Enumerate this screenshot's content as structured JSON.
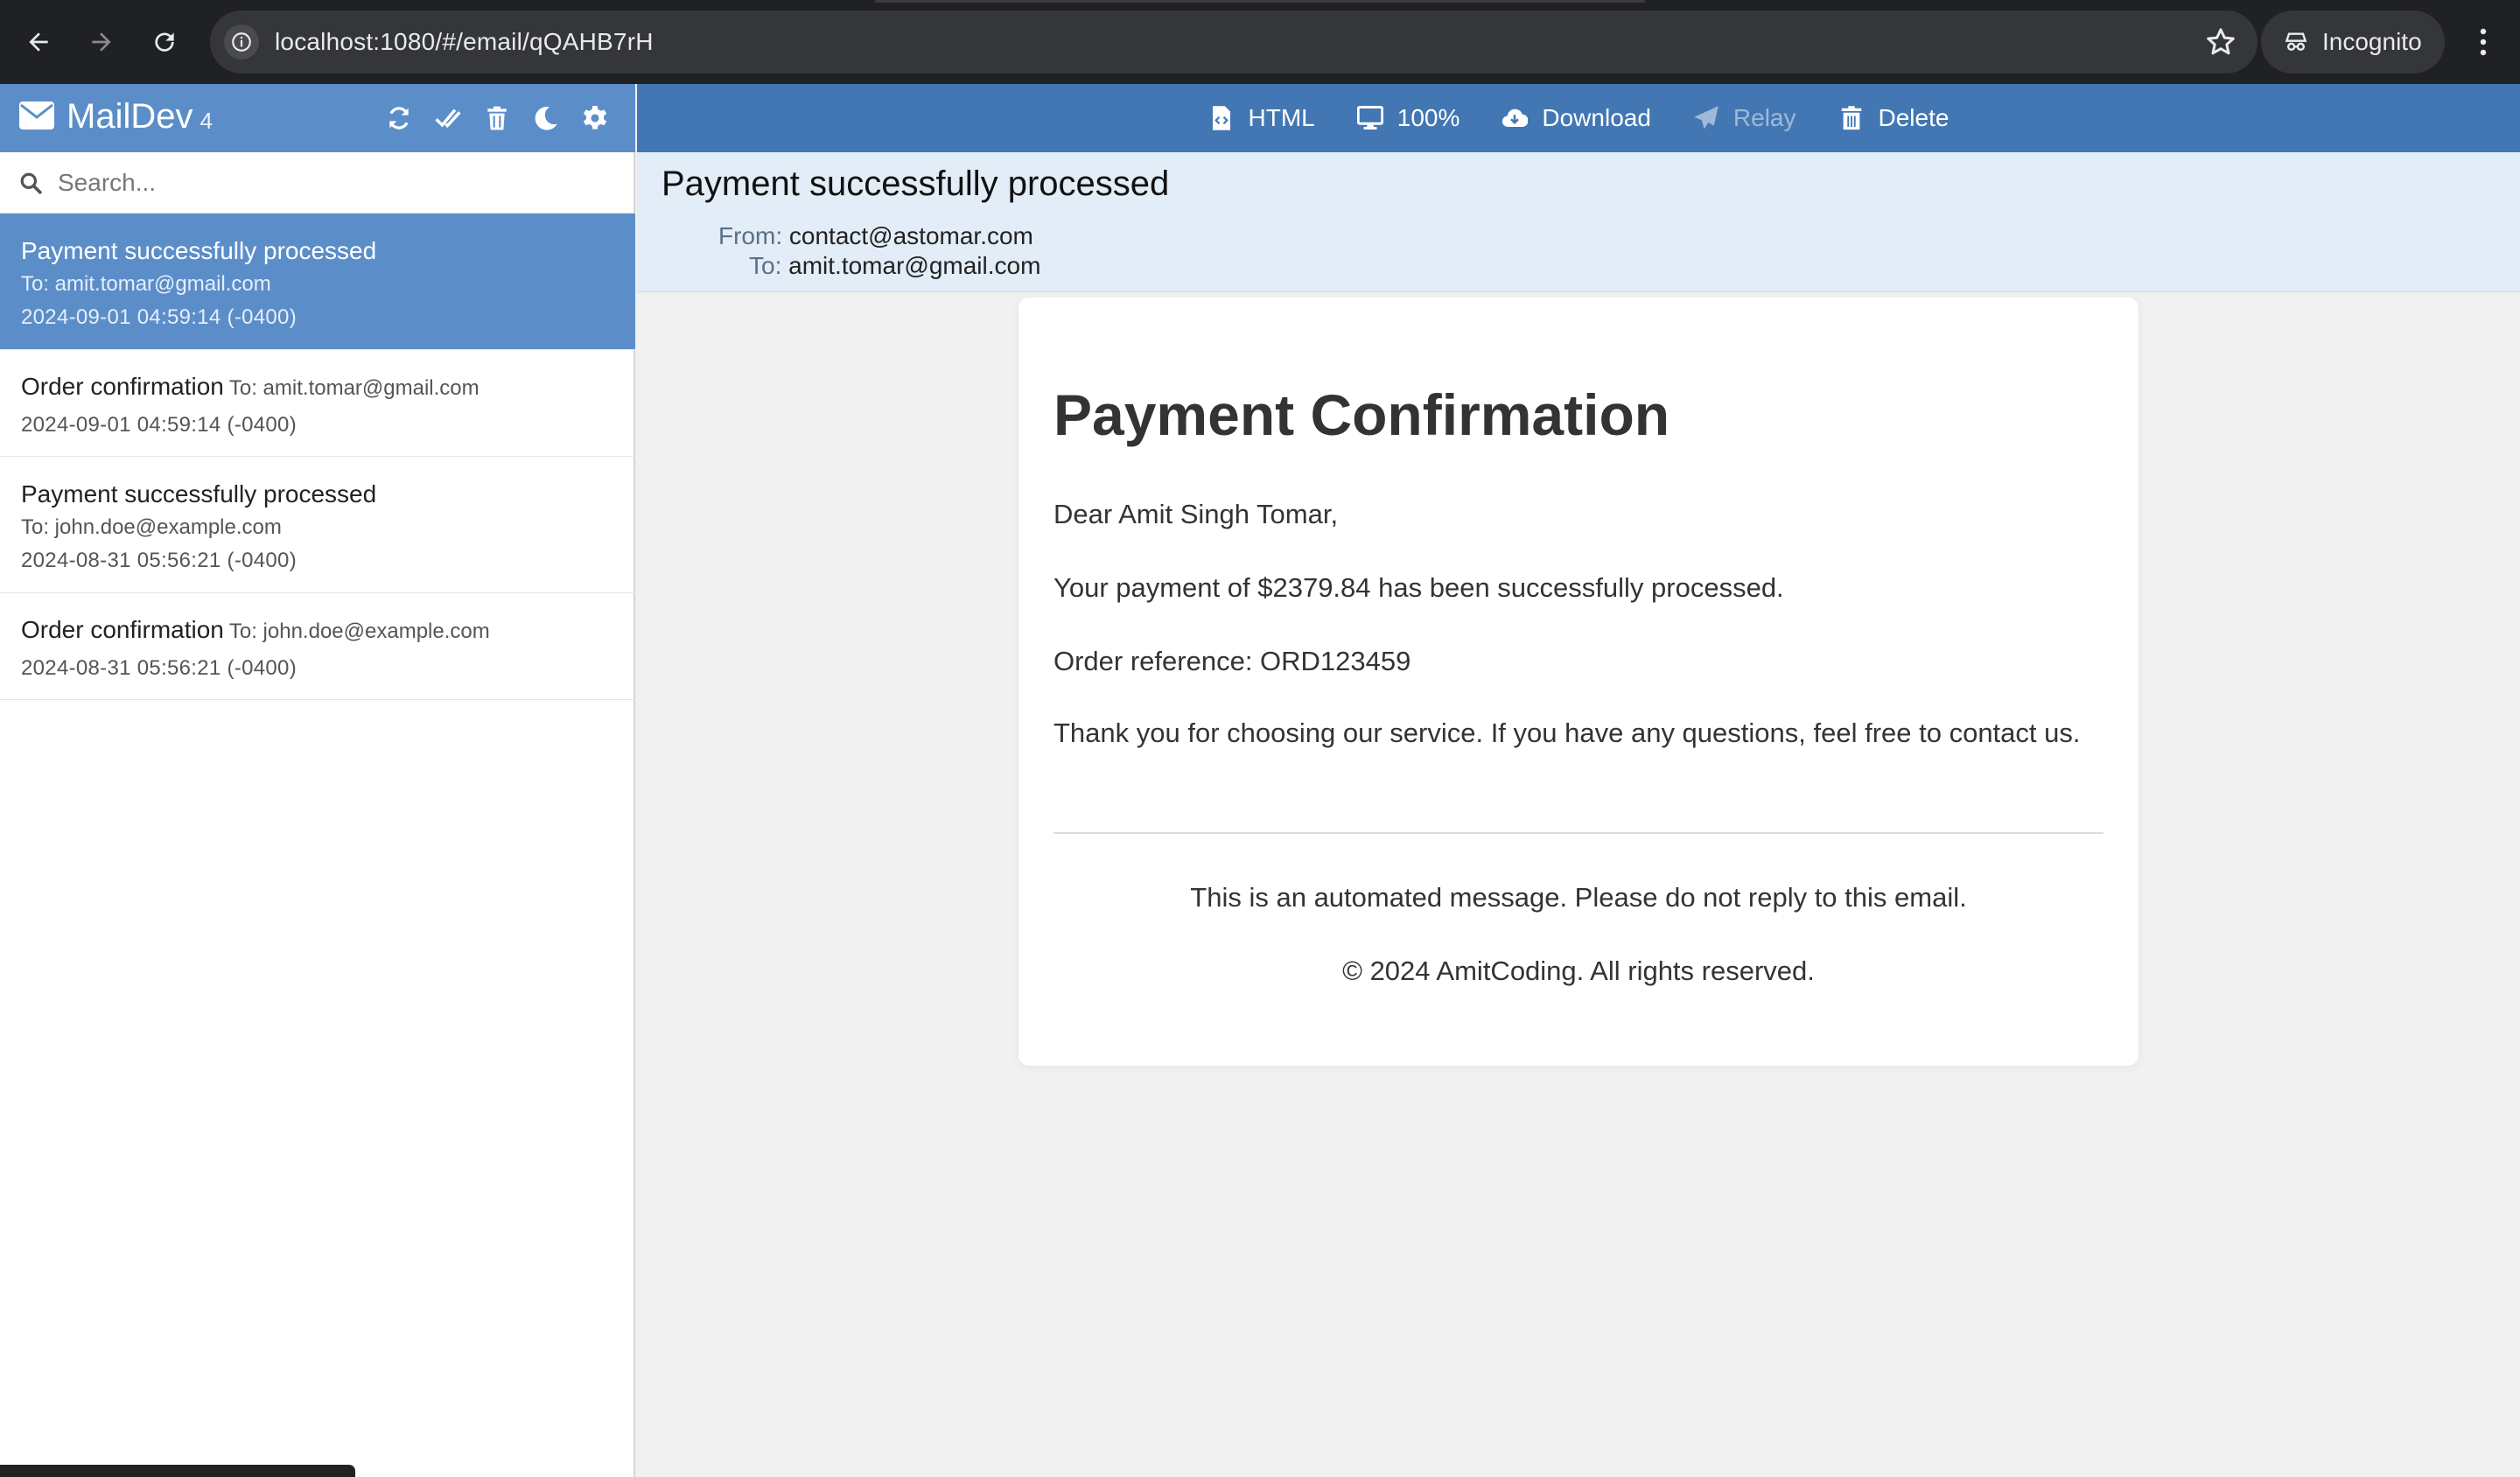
{
  "browser": {
    "url": "localhost:1080/#/email/qQAHB7rH",
    "profile_label": "Incognito"
  },
  "app": {
    "name": "MailDev",
    "count": "4",
    "search_placeholder": "Search...",
    "accent_color": "#5b8ec9",
    "toolbar_color": "#4277b3"
  },
  "emails": [
    {
      "subject": "Payment successfully processed",
      "to": "To: amit.tomar@gmail.com",
      "date": "2024-09-01 04:59:14 (-0400)",
      "selected": true
    },
    {
      "subject": "Order confirmation",
      "to": "To: amit.tomar@gmail.com",
      "date": "2024-09-01 04:59:14 (-0400)",
      "selected": false
    },
    {
      "subject": "Payment successfully processed",
      "to": "To: john.doe@example.com",
      "date": "2024-08-31 05:56:21 (-0400)",
      "selected": false
    },
    {
      "subject": "Order confirmation",
      "to": "To: john.doe@example.com",
      "date": "2024-08-31 05:56:21 (-0400)",
      "selected": false
    }
  ],
  "toolbar": {
    "html_label": "HTML",
    "zoom_label": "100%",
    "download_label": "Download",
    "relay_label": "Relay",
    "delete_label": "Delete"
  },
  "message": {
    "subject": "Payment successfully processed",
    "from_label": "From:",
    "from": "contact@astomar.com",
    "to_label": "To:",
    "to": "amit.tomar@gmail.com"
  },
  "body": {
    "heading": "Payment Confirmation",
    "greeting": "Dear Amit Singh Tomar,",
    "payment_line": "Your payment of $2379.84 has been successfully processed.",
    "reference_line": "Order reference: ORD123459",
    "thanks_line": "Thank you for choosing our service. If you have any questions, feel free to contact us.",
    "footer_notice": "This is an automated message. Please do not reply to this email.",
    "copyright": "© 2024 AmitCoding. All rights reserved."
  }
}
